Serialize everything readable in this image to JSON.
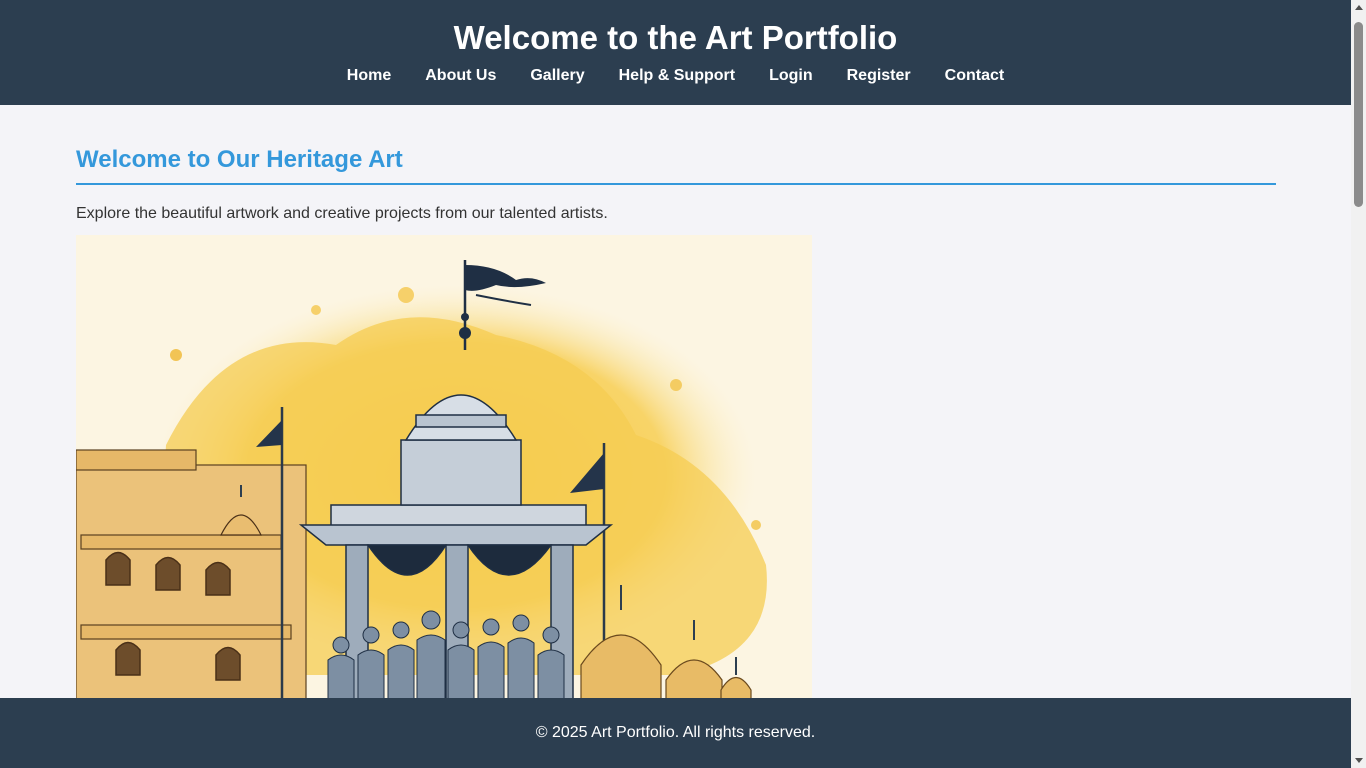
{
  "header": {
    "title": "Welcome to the Art Portfolio",
    "nav": [
      "Home",
      "About Us",
      "Gallery",
      "Help & Support",
      "Login",
      "Register",
      "Contact"
    ]
  },
  "main": {
    "section_title": "Welcome to Our Heritage Art",
    "intro": "Explore the beautiful artwork and creative projects from our talented artists."
  },
  "footer": {
    "text": "© 2025 Art Portfolio. All rights reserved."
  },
  "colors": {
    "header_bg": "#2c3e50",
    "accent": "#3498db",
    "page_bg": "#f4f4f8"
  }
}
